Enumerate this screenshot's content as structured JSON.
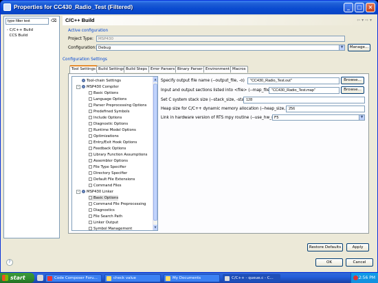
{
  "window": {
    "title": "Properties for CC430_Radio_Test (Filtered)",
    "min_icon": "minimize-icon",
    "max_icon": "maximize-icon",
    "close_icon": "close-icon"
  },
  "left": {
    "filter_placeholder": "type filter text",
    "filter_value": "type filter text",
    "items": [
      "C/C++ Build",
      "CCS Build"
    ]
  },
  "header": {
    "title": "C/C++ Build",
    "nav": "⇦ ▾ ⇨ ▾"
  },
  "active_config": {
    "group_label": "Active configuration",
    "project_type_label": "Project Type:",
    "project_type_value": "MSP430",
    "configuration_label": "Configuration:",
    "configuration_value": "Debug",
    "manage_label": "Manage..."
  },
  "config_settings": {
    "group_label": "Configuration Settings"
  },
  "tabs": [
    "Tool Settings",
    "Build Settings",
    "Build Steps",
    "Error Parsers",
    "Binary Parser",
    "Environment",
    "Macros"
  ],
  "tree": [
    {
      "label": "Tool-chain Settings",
      "level": 0,
      "icon": "gear"
    },
    {
      "label": "MSP430 Compiler",
      "level": 0,
      "icon": "gear",
      "expander": "-"
    },
    {
      "label": "Basic Options",
      "level": 1,
      "icon": "page"
    },
    {
      "label": "Language Options",
      "level": 1,
      "icon": "page"
    },
    {
      "label": "Parser Preprocessing Options",
      "level": 1,
      "icon": "page"
    },
    {
      "label": "Predefined Symbols",
      "level": 1,
      "icon": "page"
    },
    {
      "label": "Include Options",
      "level": 1,
      "icon": "page"
    },
    {
      "label": "Diagnostic Options",
      "level": 1,
      "icon": "page"
    },
    {
      "label": "Runtime Model Options",
      "level": 1,
      "icon": "page"
    },
    {
      "label": "Optimizations",
      "level": 1,
      "icon": "page"
    },
    {
      "label": "Entry/Exit Hook Options",
      "level": 1,
      "icon": "page"
    },
    {
      "label": "Feedback Options",
      "level": 1,
      "icon": "page"
    },
    {
      "label": "Library Function Assumptions",
      "level": 1,
      "icon": "page"
    },
    {
      "label": "Assembler Options",
      "level": 1,
      "icon": "page"
    },
    {
      "label": "File Type Specifier",
      "level": 1,
      "icon": "page"
    },
    {
      "label": "Directory Specifier",
      "level": 1,
      "icon": "page"
    },
    {
      "label": "Default File Extensions",
      "level": 1,
      "icon": "page"
    },
    {
      "label": "Command Files",
      "level": 1,
      "icon": "page"
    },
    {
      "label": "MSP430 Linker",
      "level": 0,
      "icon": "gear",
      "expander": "-"
    },
    {
      "label": "Basic Options",
      "level": 1,
      "icon": "page",
      "selected": true
    },
    {
      "label": "Command File Preprocessing",
      "level": 1,
      "icon": "page"
    },
    {
      "label": "Diagnostics",
      "level": 1,
      "icon": "page"
    },
    {
      "label": "File Search Path",
      "level": 1,
      "icon": "page"
    },
    {
      "label": "Linker Output",
      "level": 1,
      "icon": "page"
    },
    {
      "label": "Symbol Management",
      "level": 1,
      "icon": "page"
    }
  ],
  "options": {
    "output_label": "Specify output file name (--output_file, -o)",
    "output_value": "\"CC430_Radio_Test.out\"",
    "map_label": "Input and output sections listed into <file> (--map_file, -m)",
    "map_value": "\"CC430_Radio_Test.map\"",
    "browse_label": "Browse...",
    "stack_label": "Set C system stack size (--stack_size, -stack)",
    "stack_value": "128",
    "heap_label": "Heap size for C/C++ dynamic memory allocation (--heap_size, -heap)",
    "heap_value": "256",
    "mpy_label": "Link in hardware version of RTS mpy routine (--use_hw_mpy)",
    "mpy_value": "F5"
  },
  "buttons": {
    "restore": "Restore Defaults",
    "apply": "Apply",
    "ok": "OK",
    "cancel": "Cancel"
  },
  "taskbar": {
    "start": "start",
    "tasks": [
      "Code Composer Foru...",
      "check value",
      "My Documents",
      "C/C++ - queue.c - C..."
    ],
    "time": "12:56 PM"
  }
}
